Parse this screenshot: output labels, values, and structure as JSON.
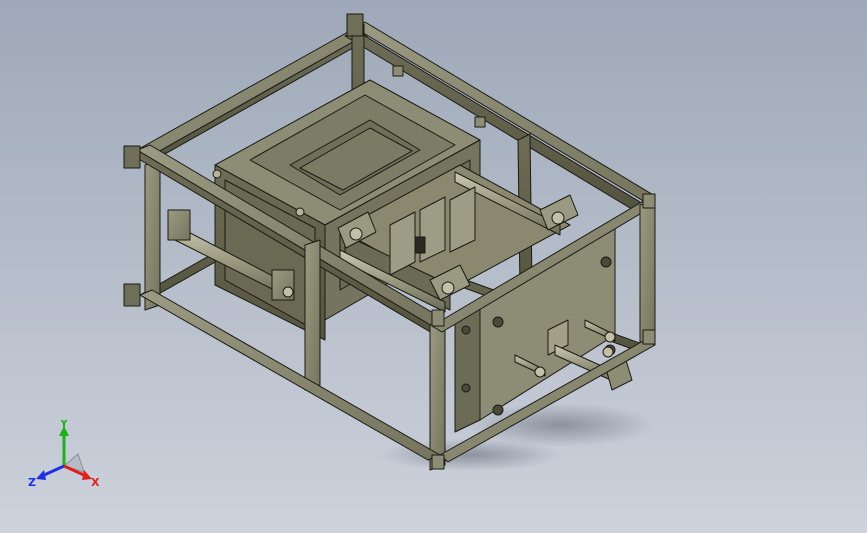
{
  "view": {
    "background_top": "#9ea8b8",
    "background_bottom": "#cdd2dc",
    "model_color": "#8a8a72",
    "edge_color": "#1a1a14"
  },
  "triad": {
    "x_label": "X",
    "y_label": "Y",
    "z_label": "Z",
    "x_color": "#e0201c",
    "y_color": "#1cb01c",
    "z_color": "#2030e0"
  }
}
